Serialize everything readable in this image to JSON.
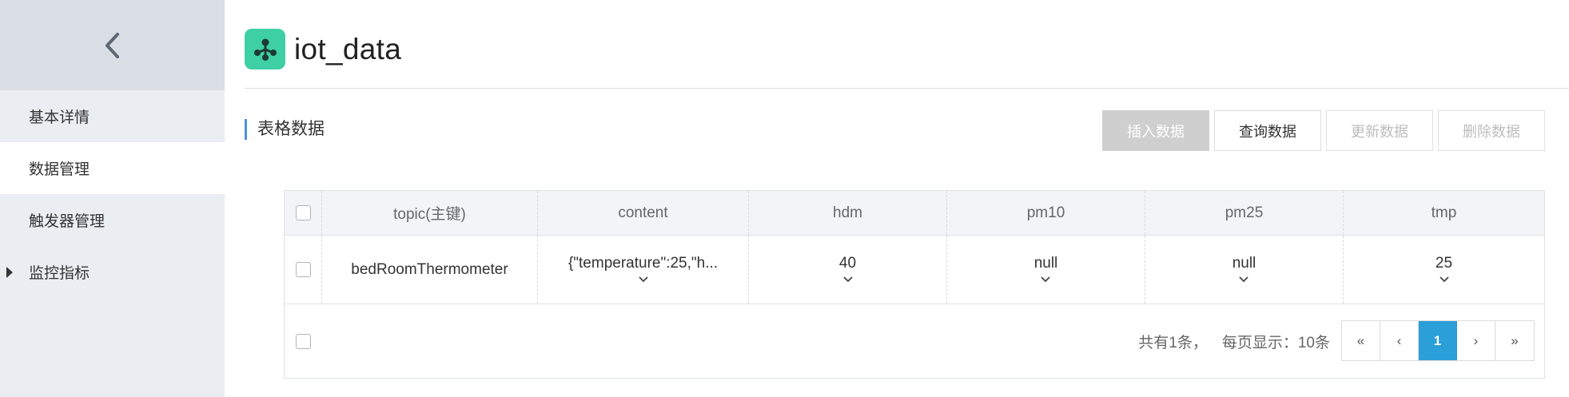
{
  "sidebar": {
    "back_icon": "chevron-left-icon",
    "items": [
      {
        "label": "基本详情",
        "active": false
      },
      {
        "label": "数据管理",
        "active": true
      },
      {
        "label": "触发器管理",
        "active": false
      },
      {
        "label": "监控指标",
        "active": false,
        "has_caret": true
      }
    ]
  },
  "header": {
    "title": "iot_data",
    "logo_icon": "tree-node-icon",
    "logo_color": "#3fcfa5"
  },
  "section": {
    "title": "表格数据",
    "accent_color": "#4a90e2"
  },
  "toolbar": {
    "insert_label": "插入数据",
    "query_label": "查询数据",
    "update_label": "更新数据",
    "delete_label": "删除数据"
  },
  "table": {
    "columns": [
      "topic(主键)",
      "content",
      "hdm",
      "pm10",
      "pm25",
      "tmp"
    ],
    "rows": [
      {
        "topic": "bedRoomThermometer",
        "content": "{\"temperature\":25,\"h...",
        "hdm": "40",
        "pm10": "null",
        "pm25": "null",
        "tmp": "25"
      }
    ]
  },
  "footer": {
    "total_text": "共有1条，",
    "page_size_text": "每页显示：10条"
  },
  "pagination": {
    "first": "«",
    "prev": "‹",
    "current": "1",
    "next": "›",
    "last": "»",
    "active_color": "#2a9fd8"
  }
}
